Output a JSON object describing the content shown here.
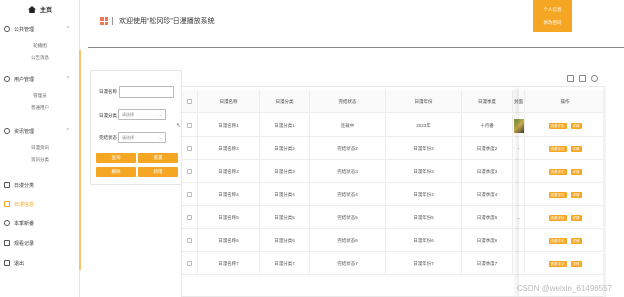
{
  "sidebar": {
    "home": "主页",
    "groups": [
      {
        "title": "公共管理",
        "subs": [
          "轮播图",
          "公告消息"
        ]
      },
      {
        "title": "用户管理",
        "subs": [
          "管理员",
          "普通用户"
        ]
      },
      {
        "title": "资讯管理",
        "subs": [
          "日漫资讯",
          "资讯分类"
        ]
      }
    ],
    "items": [
      "日漫分类",
      "日漫信息",
      "本季新番",
      "观看记录",
      "退出"
    ]
  },
  "header": {
    "title": "欢迎使用“松冈珍”日漫播放系统",
    "menu": [
      "个人信息",
      "修改密码"
    ]
  },
  "search": {
    "name_label": "日漫名称",
    "category_label": "日漫分类",
    "status_label": "完结状态",
    "select_placeholder": "请选择",
    "buttons": [
      "查询",
      "重置",
      "删除",
      "新增"
    ]
  },
  "table": {
    "headers": [
      "日漫名称",
      "日漫分类",
      "完结状态",
      "日漫年份",
      "日漫季度",
      "封面",
      "操作"
    ],
    "rows": [
      [
        "日漫名称1",
        "日漫分类1",
        "连载中",
        "2023年",
        "十月番"
      ],
      [
        "日漫名称2",
        "日漫分类2",
        "完结状态2",
        "日漫年份2",
        "日漫季度2"
      ],
      [
        "日漫名称3",
        "日漫分类3",
        "完结状态3",
        "日漫年份3",
        "日漫季度3"
      ],
      [
        "日漫名称4",
        "日漫分类4",
        "完结状态4",
        "日漫年份4",
        "日漫季度4"
      ],
      [
        "日漫名称5",
        "日漫分类5",
        "完结状态5",
        "日漫年份5",
        "日漫季度5"
      ],
      [
        "日漫名称6",
        "日漫分类6",
        "完结状态6",
        "日漫年份6",
        "日漫季度6"
      ],
      [
        "日漫名称7",
        "日漫分类7",
        "完结状态7",
        "日漫年份7",
        "日漫季度7"
      ]
    ],
    "row_marks": [
      "",
      "-",
      "",
      "",
      "...",
      "",
      ""
    ],
    "op_buttons": [
      "查看评论",
      "详情"
    ]
  },
  "watermark": "CSDN @weixin_61498557",
  "colors": {
    "accent": "#f5a623",
    "logo": "#e9785a"
  }
}
